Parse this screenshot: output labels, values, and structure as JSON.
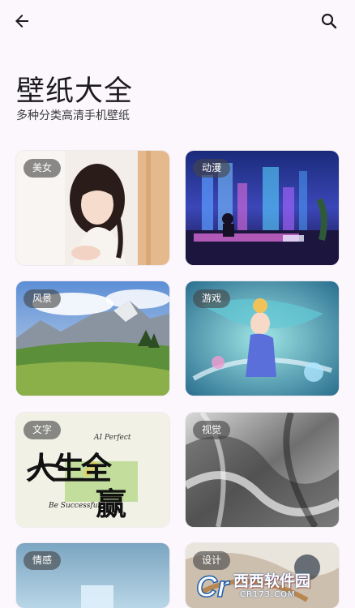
{
  "header": {
    "back_icon": "arrow-left-icon",
    "search_icon": "magnifier-icon"
  },
  "page": {
    "title": "壁纸大全",
    "subtitle": "多种分类高清手机壁纸"
  },
  "categories": [
    {
      "label": "美女",
      "icon": "photo"
    },
    {
      "label": "动漫",
      "icon": "photo"
    },
    {
      "label": "风景",
      "icon": "photo"
    },
    {
      "label": "游戏",
      "icon": "photo"
    },
    {
      "label": "文字",
      "icon": "photo"
    },
    {
      "label": "视觉",
      "icon": "photo"
    },
    {
      "label": "情感",
      "icon": "photo"
    },
    {
      "label": "设计",
      "icon": "photo"
    }
  ],
  "artwork_text": {
    "calligraphy_main": "人生全",
    "calligraphy_sub": "赢",
    "small_line": "Be Successful",
    "ai_line": "AI Perfect"
  },
  "watermark": {
    "brand": "西西软件园",
    "url": "CR173.COM"
  },
  "colors": {
    "background": "#fbf7fd",
    "badge": "#464646"
  }
}
